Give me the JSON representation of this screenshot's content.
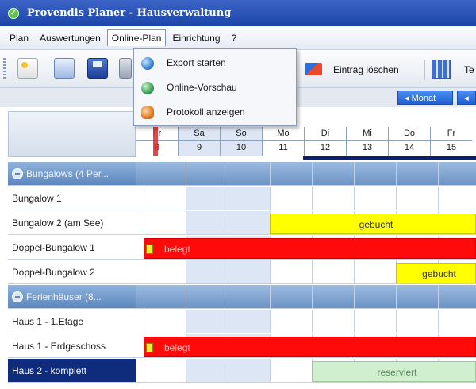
{
  "window": {
    "title": "Provendis Planer - Hausverwaltung"
  },
  "menu": {
    "items": [
      "Plan",
      "Auswertungen",
      "Online-Plan",
      "Einrichtung",
      "?"
    ],
    "open_index": 2,
    "dropdown": [
      {
        "label": "Export starten",
        "icon": "export-icon"
      },
      {
        "label": "Online-Vorschau",
        "icon": "globe-icon"
      },
      {
        "label": "Protokoll anzeigen",
        "icon": "log-icon"
      }
    ]
  },
  "toolbar": {
    "delete_label": "Eintrag löschen",
    "te_label": "Te"
  },
  "nav": {
    "month_label": "◂ Monat",
    "next_label": "◂"
  },
  "days": [
    {
      "name": "Fr",
      "date": "8",
      "weekend": false,
      "today": true
    },
    {
      "name": "Sa",
      "date": "9",
      "weekend": true
    },
    {
      "name": "So",
      "date": "10",
      "weekend": true
    },
    {
      "name": "Mo",
      "date": "11",
      "weekend": false
    },
    {
      "name": "Di",
      "date": "12",
      "weekend": false
    },
    {
      "name": "Mi",
      "date": "13",
      "weekend": false
    },
    {
      "name": "Do",
      "date": "14",
      "weekend": false
    },
    {
      "name": "Fr",
      "date": "15",
      "weekend": false
    }
  ],
  "rows": [
    {
      "label": "Bungalows (4 Per...",
      "type": "group"
    },
    {
      "label": "Bungalow 1",
      "type": "unit"
    },
    {
      "label": "Bungalow 2 (am See)",
      "type": "unit",
      "booking": {
        "text": "gebucht",
        "status": "yellow",
        "start": 3,
        "end": 8
      }
    },
    {
      "label": "Doppel-Bungalow 1",
      "type": "unit",
      "booking": {
        "text": "belegt",
        "status": "red",
        "start": 0,
        "end": 8,
        "flag": true
      }
    },
    {
      "label": "Doppel-Bungalow 2",
      "type": "unit",
      "booking": {
        "text": "gebucht",
        "status": "yellow",
        "start": 6,
        "end": 8
      }
    },
    {
      "label": "Ferienhäuser (8...",
      "type": "group"
    },
    {
      "label": "Haus 1 - 1.Etage",
      "type": "unit"
    },
    {
      "label": "Haus 1 - Erdgeschoss",
      "type": "unit",
      "booking": {
        "text": "belegt",
        "status": "red",
        "start": 0,
        "end": 8,
        "flag": true
      }
    },
    {
      "label": "Haus 2 - komplett",
      "type": "unit",
      "selected": true,
      "booking": {
        "text": "reserviert",
        "status": "green",
        "start": 4,
        "end": 8
      }
    }
  ]
}
